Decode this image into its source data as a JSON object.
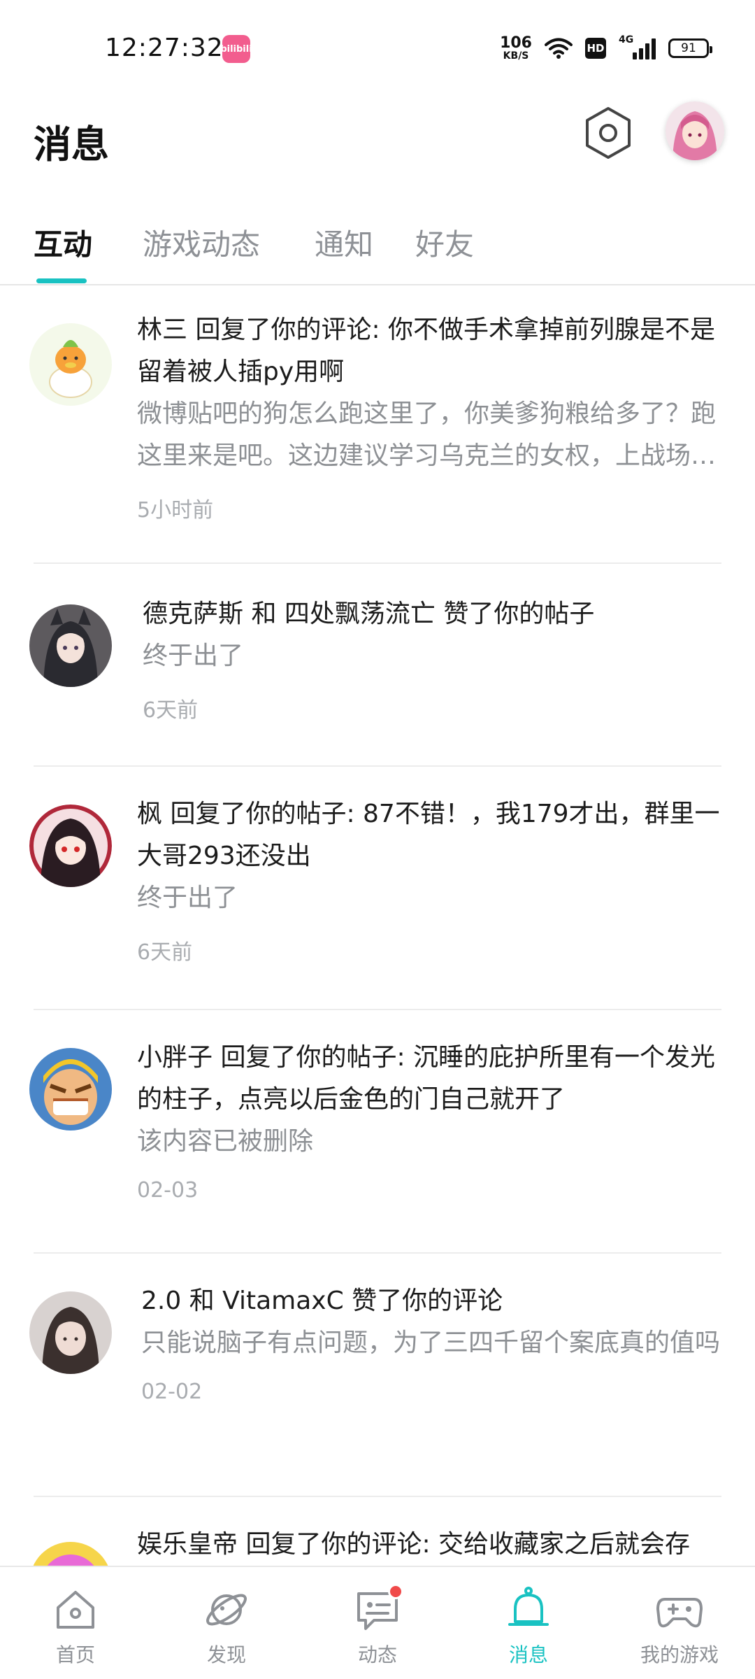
{
  "status_bar": {
    "time": "12:27:32",
    "app_icon_text": "bilibili",
    "net_speed_value": "106",
    "net_speed_unit": "KB/S",
    "hd_badge": "HD",
    "signal_label": "4G",
    "battery": "91"
  },
  "header": {
    "title": "消息",
    "settings_icon": "hexagon-settings-icon",
    "avatar": "user-avatar"
  },
  "tabs": [
    {
      "label": "互动",
      "active": true
    },
    {
      "label": "游戏动态",
      "active": false
    },
    {
      "label": "通知",
      "active": false
    },
    {
      "label": "好友",
      "active": false
    }
  ],
  "messages": [
    {
      "headline": "林三 回复了你的评论: 你不做手术拿掉前列腺是不是留着被人插py用啊",
      "preview": "微博贴吧的狗怎么跑这里了，你美爹狗粮给多了？跑这里来是吧。这边建议学习乌克兰的女权，上战场保家卫国，证明一下实力",
      "time": "5小时前"
    },
    {
      "headline": "德克萨斯 和 四处飘荡流亡 赞了你的帖子",
      "preview": "终于出了",
      "time": "6天前"
    },
    {
      "headline": "枫 回复了你的帖子: 87不错！，我179才出，群里一大哥293还没出",
      "preview": "终于出了",
      "time": "6天前"
    },
    {
      "headline": "小胖子 回复了你的帖子: 沉睡的庇护所里有一个发光的柱子，点亮以后金色的门自己就开了",
      "preview": "该内容已被删除",
      "time": "02-03"
    },
    {
      "headline": "2.0 和 VitamaxC 赞了你的评论",
      "preview": "只能说脑子有点问题，为了三四千留个案底真的值吗",
      "time": "02-02"
    },
    {
      "headline": "娱乐皇帝 回复了你的评论: 交给收藏家之后就会存",
      "preview": "",
      "time": ""
    }
  ],
  "bottom_nav": [
    {
      "label": "首页",
      "icon": "home-icon",
      "active": false
    },
    {
      "label": "发现",
      "icon": "planet-icon",
      "active": false
    },
    {
      "label": "动态",
      "icon": "chat-icon",
      "active": false,
      "badge": true
    },
    {
      "label": "消息",
      "icon": "bell-icon",
      "active": true
    },
    {
      "label": "我的游戏",
      "icon": "gamepad-icon",
      "active": false
    }
  ],
  "colors": {
    "accent": "#19c2c2",
    "badge": "#f04a4a",
    "secondary_text": "#8d9094"
  }
}
